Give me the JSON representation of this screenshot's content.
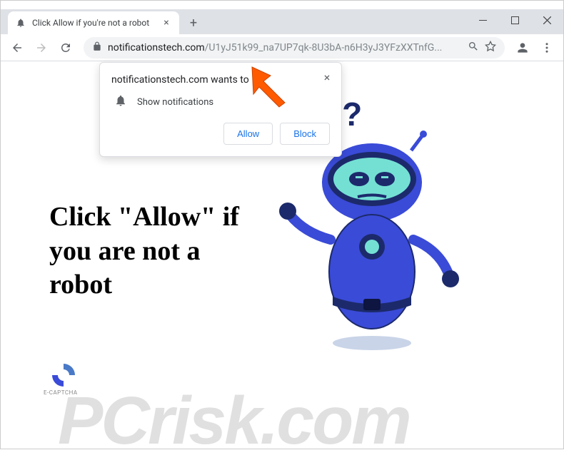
{
  "window": {
    "tab_title": "Click Allow if you're not a robot"
  },
  "omnibox": {
    "domain": "notificationstech.com",
    "path": "/U1yJ51k99_na7UP7qk-8U3bA-n6H3yJ3YFzXXTnfG..."
  },
  "prompt": {
    "title": "notificationstech.com wants to",
    "permission_text": "Show notifications",
    "allow_label": "Allow",
    "block_label": "Block"
  },
  "page": {
    "headline": "Click \"Allow\" if you are not a robot",
    "captcha_label": "E-CAPTCHA"
  },
  "watermark": {
    "text": "PCrisk.com"
  }
}
